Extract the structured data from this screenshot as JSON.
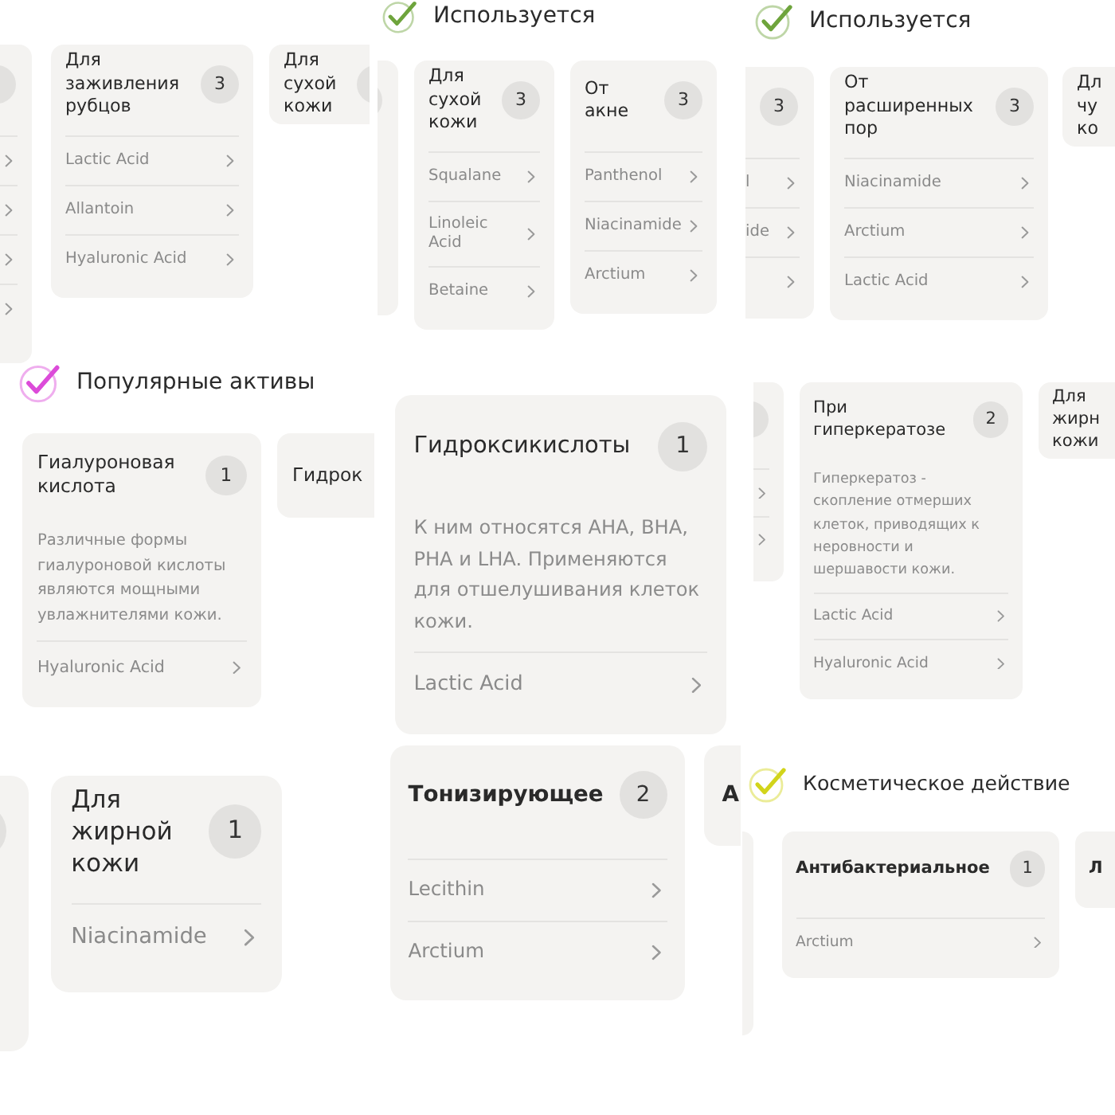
{
  "panels": [
    {
      "cards": [
        {
          "kind": "cut-left",
          "badge_edge": true,
          "items": [
            {
              "kind": "chevron"
            },
            {
              "kind": "chevron"
            },
            {
              "kind": "chevron"
            },
            {
              "kind": "chevron"
            }
          ]
        },
        {
          "kind": "full",
          "title": "Для заживления рубцов",
          "count": "3",
          "items": [
            {
              "label": "Lactic Acid"
            },
            {
              "label": "Allantoin"
            },
            {
              "label": "Hyaluronic Acid"
            }
          ]
        },
        {
          "kind": "cut-right",
          "title": "Для сухой кожи",
          "badge_edge": true
        }
      ]
    },
    {
      "header": {
        "title": "Используется",
        "color": "#6ea43c"
      },
      "cards": [
        {
          "kind": "cut-left",
          "badge_edge": true
        },
        {
          "kind": "full",
          "title": "Для сухой кожи",
          "count": "3",
          "items": [
            {
              "label": "Squalane"
            },
            {
              "label": "Linoleic Acid"
            },
            {
              "label": "Betaine"
            }
          ]
        },
        {
          "kind": "full",
          "title": "От акне",
          "count": "3",
          "items": [
            {
              "label": "Panthenol"
            },
            {
              "label": "Niacinamide"
            },
            {
              "label": "Arctium"
            }
          ]
        }
      ]
    },
    {
      "header": {
        "title": "Используется",
        "color": "#6ea43c"
      },
      "cards": [
        {
          "kind": "cut-left",
          "count": "3",
          "items": [
            {
              "kind": "text",
              "label": "l"
            },
            {
              "kind": "text",
              "label": "ide"
            },
            {
              "kind": "chevron"
            }
          ]
        },
        {
          "kind": "full",
          "title": "От расширенных пор",
          "count": "3",
          "items": [
            {
              "label": "Niacinamide"
            },
            {
              "label": "Arctium"
            },
            {
              "label": "Lactic Acid"
            }
          ]
        },
        {
          "kind": "cut-right",
          "title": "Дл чу ко"
        }
      ]
    },
    {
      "header": {
        "title": "Популярные активы",
        "color": "#dc4bd9"
      },
      "cards": [
        {
          "kind": "full",
          "title": "Гиалуроновая кислота",
          "count": "1",
          "description": "Различные формы гиалуроновой кислоты являются мощными увлажнителями кожи.",
          "items": [
            {
              "label": "Hyaluronic Acid"
            }
          ]
        },
        {
          "kind": "cut-right",
          "title": "Гидрок"
        }
      ]
    },
    {
      "cards": [
        {
          "kind": "full",
          "title": "Гидроксикислоты",
          "count": "1",
          "description": "К ним относятся AHA, BHA, PHA и LHA. Применяются для отшелушивания клеток кожи.",
          "items": [
            {
              "label": "Lactic Acid"
            }
          ]
        }
      ]
    },
    {
      "cards": [
        {
          "kind": "cut-left",
          "badge_edge": true,
          "items": [
            {
              "kind": "chevron"
            },
            {
              "kind": "chevron"
            }
          ]
        },
        {
          "kind": "full",
          "title": "При гиперкератозе",
          "count": "2",
          "description": "Гиперкератоз - скопление отмерших клеток, приводящих к неровности и шершавости кожи.",
          "items": [
            {
              "label": "Lactic Acid"
            },
            {
              "label": "Hyaluronic Acid"
            }
          ]
        },
        {
          "kind": "cut-right",
          "title": "Для жирн кожи"
        }
      ]
    },
    {
      "cards": [
        {
          "kind": "cut-left",
          "badge_edge": true
        },
        {
          "kind": "full",
          "title": "Для жирной кожи",
          "count": "1",
          "items": [
            {
              "label": "Niacinamide"
            }
          ]
        }
      ]
    },
    {
      "cards": [
        {
          "kind": "full",
          "title": "Тонизирующее",
          "count": "2",
          "items": [
            {
              "label": "Lecithin"
            },
            {
              "label": "Arctium"
            }
          ]
        },
        {
          "kind": "cut-right",
          "title": "А"
        }
      ]
    },
    {
      "header": {
        "title": "Косметическое действие",
        "color": "#d2d41a"
      },
      "cards": [
        {
          "kind": "cut-left"
        },
        {
          "kind": "full",
          "title": "Антибактериальное",
          "count": "1",
          "items": [
            {
              "label": "Arctium"
            }
          ]
        },
        {
          "kind": "cut-right",
          "title": "Л"
        }
      ]
    }
  ]
}
